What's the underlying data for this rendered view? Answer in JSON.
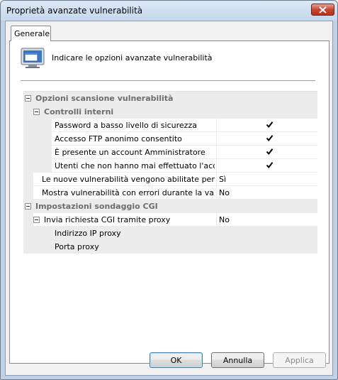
{
  "window": {
    "title": "Proprietà avanzate vulnerabilità"
  },
  "tabs": [
    {
      "label": "Generale"
    }
  ],
  "header": {
    "text": "Indicare le opzioni avanzate vulnerabilità",
    "icon": "monitor-window-icon"
  },
  "grid": {
    "categories": [
      {
        "label": "Opzioni scansione vulnerabilità"
      },
      {
        "label": "Controlli interni"
      },
      {
        "label": "Impostazioni sondaggio CGI"
      }
    ],
    "rows": [
      {
        "name": "Password a basso livello di sicurezza",
        "checked": true
      },
      {
        "name": "Accesso FTP anonimo consentito",
        "checked": true
      },
      {
        "name": "È presente un account Amministratore",
        "checked": true
      },
      {
        "name": "Utenti che non hanno mai effettuato l'accesso",
        "checked": true
      },
      {
        "name": "Le nuove vulnerabilità vengono abilitate per impostazione predefinita",
        "value": "Sì"
      },
      {
        "name": "Mostra vulnerabilità con errori durante la valutazione",
        "value": "No"
      },
      {
        "name": "Invia richiesta CGI tramite proxy",
        "value": "No"
      },
      {
        "name": "Indirizzo IP proxy",
        "value": ""
      },
      {
        "name": "Porta proxy",
        "value": ""
      }
    ]
  },
  "buttons": {
    "ok": "OK",
    "cancel": "Annulla",
    "apply": "Applica"
  }
}
